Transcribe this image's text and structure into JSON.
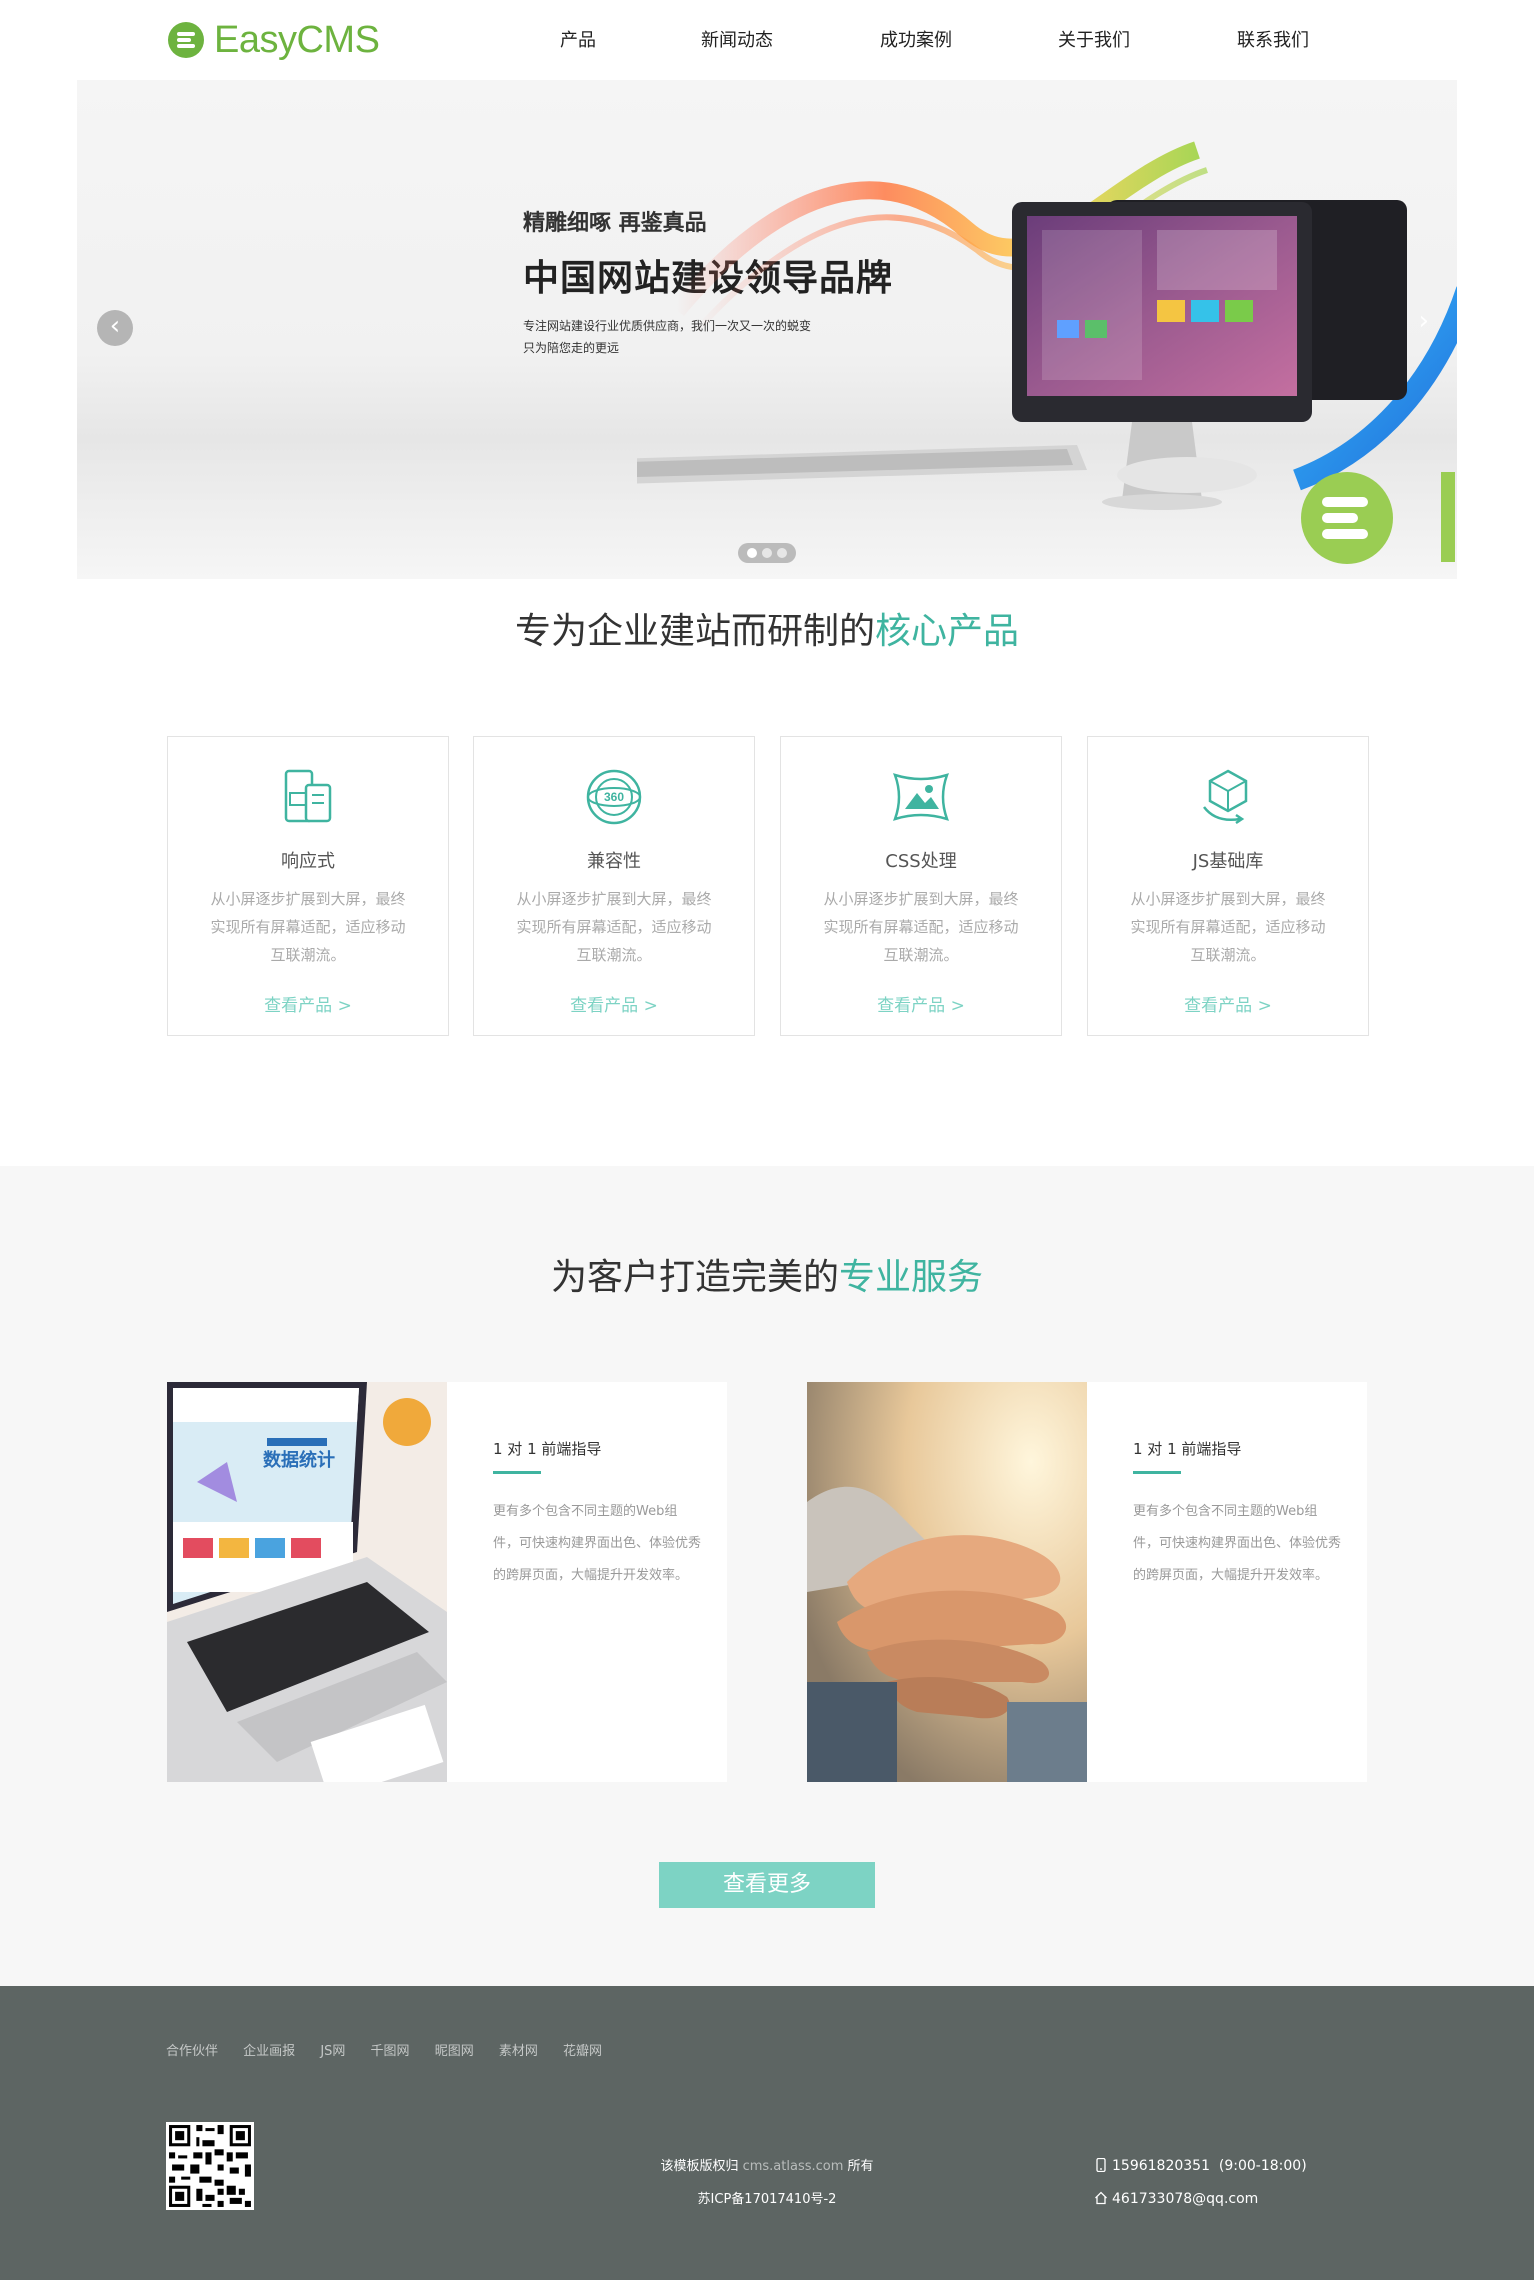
{
  "header": {
    "logo_text": "EasyCMS",
    "nav": [
      {
        "label": "产品"
      },
      {
        "label": "新闻动态"
      },
      {
        "label": "成功案例"
      },
      {
        "label": "关于我们"
      },
      {
        "label": "联系我们"
      }
    ]
  },
  "banner": {
    "subtitle": "精雕细啄 再鉴真品",
    "title": "中国网站建设领导品牌",
    "desc_line1": "专注网站建设行业优质供应商，我们一次又一次的蜕变",
    "desc_line2": "只为陪您走的更远",
    "prev_icon": "‹",
    "next_icon": "›",
    "slide_count": 3,
    "active_slide": 1
  },
  "products_section": {
    "title_plain": "专为企业建站而研制的",
    "title_highlight": "核心产品",
    "cards": [
      {
        "icon": "responsive-devices-icon",
        "name": "响应式",
        "desc": "从小屏逐步扩展到大屏，最终实现所有屏幕适配，适应移动互联潮流。",
        "more": "查看产品 >"
      },
      {
        "icon": "360-globe-icon",
        "name": "兼容性",
        "desc": "从小屏逐步扩展到大屏，最终实现所有屏幕适配，适应移动互联潮流。",
        "more": "查看产品 >"
      },
      {
        "icon": "image-frame-icon",
        "name": "CSS处理",
        "desc": "从小屏逐步扩展到大屏，最终实现所有屏幕适配，适应移动互联潮流。",
        "more": "查看产品 >"
      },
      {
        "icon": "3d-cube-icon",
        "name": "JS基础库",
        "desc": "从小屏逐步扩展到大屏，最终实现所有屏幕适配，适应移动互联潮流。",
        "more": "查看产品 >"
      }
    ]
  },
  "services_section": {
    "title_plain": "为客户打造完美的",
    "title_highlight": "专业服务",
    "items": [
      {
        "image": "laptop-photo",
        "title": "1 对 1 前端指导",
        "desc": "更有多个包含不同主题的Web组件，可快速构建界面出色、体验优秀的跨屏页面，大幅提升开发效率。",
        "screen_heading": "数据统计"
      },
      {
        "image": "hands-photo",
        "title": "1 对 1 前端指导",
        "desc": "更有多个包含不同主题的Web组件，可快速构建界面出色、体验优秀的跨屏页面，大幅提升开发效率。"
      }
    ],
    "more_button": "查看更多"
  },
  "footer": {
    "links": [
      "合作伙伴",
      "企业画报",
      "JS网",
      "千图网",
      "昵图网",
      "素材网",
      "花瓣网"
    ],
    "copyright_prefix": "该模板版权归",
    "copyright_domain": "cms.atlass.com",
    "copyright_suffix": "所有",
    "icp": "苏ICP备17017410号-2",
    "phone": "15961820351",
    "hours": "(9:00-18:00)",
    "email": "461733078@qq.com"
  },
  "colors": {
    "brand_green": "#6db33f",
    "accent_teal": "#3fb4a0",
    "button_teal": "#7dd3c4",
    "footer_bg": "#5d6563"
  }
}
